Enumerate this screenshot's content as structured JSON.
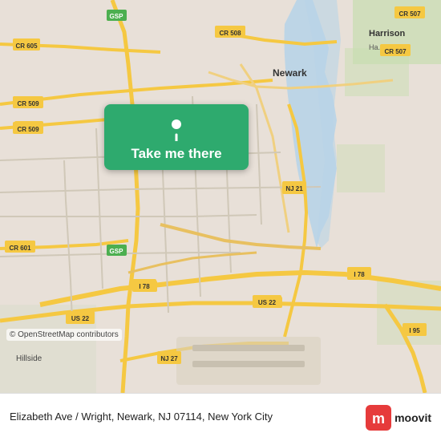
{
  "map": {
    "background_color": "#e8e0d8",
    "attribution": "© OpenStreetMap contributors"
  },
  "button": {
    "label": "Take me there",
    "background_color": "#2eaa6e",
    "text_color": "#ffffff"
  },
  "bottom_bar": {
    "address": "Elizabeth Ave / Wright, Newark, NJ 07114, New York City",
    "logo_letter": "m",
    "logo_text": "moovit"
  },
  "road_labels": {
    "cr605": "CR 605",
    "cr509_1": "CR 509",
    "cr509_2": "CR 509",
    "cr508": "CR 508",
    "cr507": "CR 507",
    "cr601": "CR 601",
    "nj21": "NJ 21",
    "i78": "I 78",
    "us22": "US 22",
    "nj27": "NJ 27",
    "us22b": "US 22",
    "i78b": "I 78",
    "i95": "I 95",
    "gsp1": "GSP",
    "gsp2": "GSP",
    "harrison": "Harrison",
    "newark": "Newark",
    "hillside": "Hillside"
  }
}
